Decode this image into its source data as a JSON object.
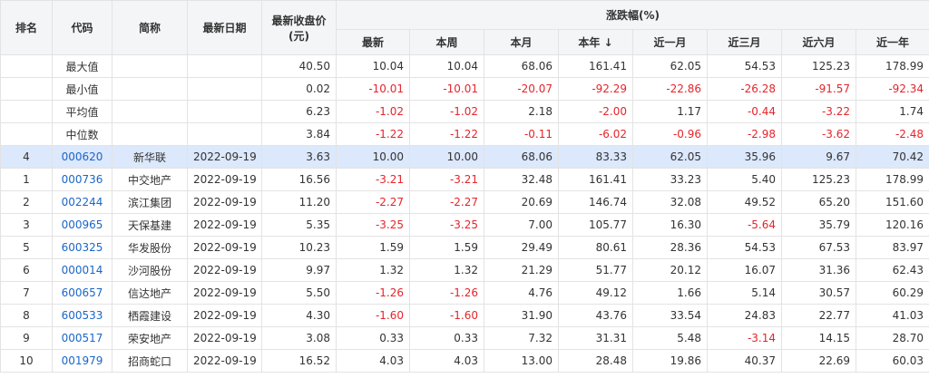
{
  "colors": {
    "negative": "#e6242a",
    "code": "#1a66c9",
    "highlight_row": "#dce8fb",
    "header_bg": "#f4f5f7"
  },
  "headers": {
    "rank": "排名",
    "code": "代码",
    "name": "简称",
    "date": "最新日期",
    "close_line1": "最新收盘价",
    "close_line2": "(元)",
    "change_group": "涨跌幅(%)",
    "change_cols": [
      "最新",
      "本周",
      "本月",
      "本年 ↓",
      "近一月",
      "近三月",
      "近六月",
      "近一年"
    ]
  },
  "stats": [
    {
      "label": "最大值",
      "close": "40.50",
      "changes": [
        "10.04",
        "10.04",
        "68.06",
        "161.41",
        "62.05",
        "54.53",
        "125.23",
        "178.99"
      ]
    },
    {
      "label": "最小值",
      "close": "0.02",
      "changes": [
        "-10.01",
        "-10.01",
        "-20.07",
        "-92.29",
        "-22.86",
        "-26.28",
        "-91.57",
        "-92.34"
      ]
    },
    {
      "label": "平均值",
      "close": "6.23",
      "changes": [
        "-1.02",
        "-1.02",
        "2.18",
        "-2.00",
        "1.17",
        "-0.44",
        "-3.22",
        "1.74"
      ]
    },
    {
      "label": "中位数",
      "close": "3.84",
      "changes": [
        "-1.22",
        "-1.22",
        "-0.11",
        "-6.02",
        "-0.96",
        "-2.98",
        "-3.62",
        "-2.48"
      ]
    }
  ],
  "rows": [
    {
      "rank": "4",
      "code": "000620",
      "name": "新华联",
      "date": "2022-09-19",
      "close": "3.63",
      "changes": [
        "10.00",
        "10.00",
        "68.06",
        "83.33",
        "62.05",
        "35.96",
        "9.67",
        "70.42"
      ],
      "highlight": true
    },
    {
      "rank": "1",
      "code": "000736",
      "name": "中交地产",
      "date": "2022-09-19",
      "close": "16.56",
      "changes": [
        "-3.21",
        "-3.21",
        "32.48",
        "161.41",
        "33.23",
        "5.40",
        "125.23",
        "178.99"
      ]
    },
    {
      "rank": "2",
      "code": "002244",
      "name": "滨江集团",
      "date": "2022-09-19",
      "close": "11.20",
      "changes": [
        "-2.27",
        "-2.27",
        "20.69",
        "146.74",
        "32.08",
        "49.52",
        "65.20",
        "151.60"
      ]
    },
    {
      "rank": "3",
      "code": "000965",
      "name": "天保基建",
      "date": "2022-09-19",
      "close": "5.35",
      "changes": [
        "-3.25",
        "-3.25",
        "7.00",
        "105.77",
        "16.30",
        "-5.64",
        "35.79",
        "120.16"
      ]
    },
    {
      "rank": "5",
      "code": "600325",
      "name": "华发股份",
      "date": "2022-09-19",
      "close": "10.23",
      "changes": [
        "1.59",
        "1.59",
        "29.49",
        "80.61",
        "28.36",
        "54.53",
        "67.53",
        "83.97"
      ]
    },
    {
      "rank": "6",
      "code": "000014",
      "name": "沙河股份",
      "date": "2022-09-19",
      "close": "9.97",
      "changes": [
        "1.32",
        "1.32",
        "21.29",
        "51.77",
        "20.12",
        "16.07",
        "31.36",
        "62.43"
      ]
    },
    {
      "rank": "7",
      "code": "600657",
      "name": "信达地产",
      "date": "2022-09-19",
      "close": "5.50",
      "changes": [
        "-1.26",
        "-1.26",
        "4.76",
        "49.12",
        "1.66",
        "5.14",
        "30.57",
        "60.29"
      ]
    },
    {
      "rank": "8",
      "code": "600533",
      "name": "栖霞建设",
      "date": "2022-09-19",
      "close": "4.30",
      "changes": [
        "-1.60",
        "-1.60",
        "31.90",
        "43.76",
        "33.54",
        "24.83",
        "22.77",
        "41.03"
      ]
    },
    {
      "rank": "9",
      "code": "000517",
      "name": "荣安地产",
      "date": "2022-09-19",
      "close": "3.08",
      "changes": [
        "0.33",
        "0.33",
        "7.32",
        "31.31",
        "5.48",
        "-3.14",
        "14.15",
        "28.70"
      ]
    },
    {
      "rank": "10",
      "code": "001979",
      "name": "招商蛇口",
      "date": "2022-09-19",
      "close": "16.52",
      "changes": [
        "4.03",
        "4.03",
        "13.00",
        "28.48",
        "19.86",
        "40.37",
        "22.69",
        "60.03"
      ]
    }
  ]
}
